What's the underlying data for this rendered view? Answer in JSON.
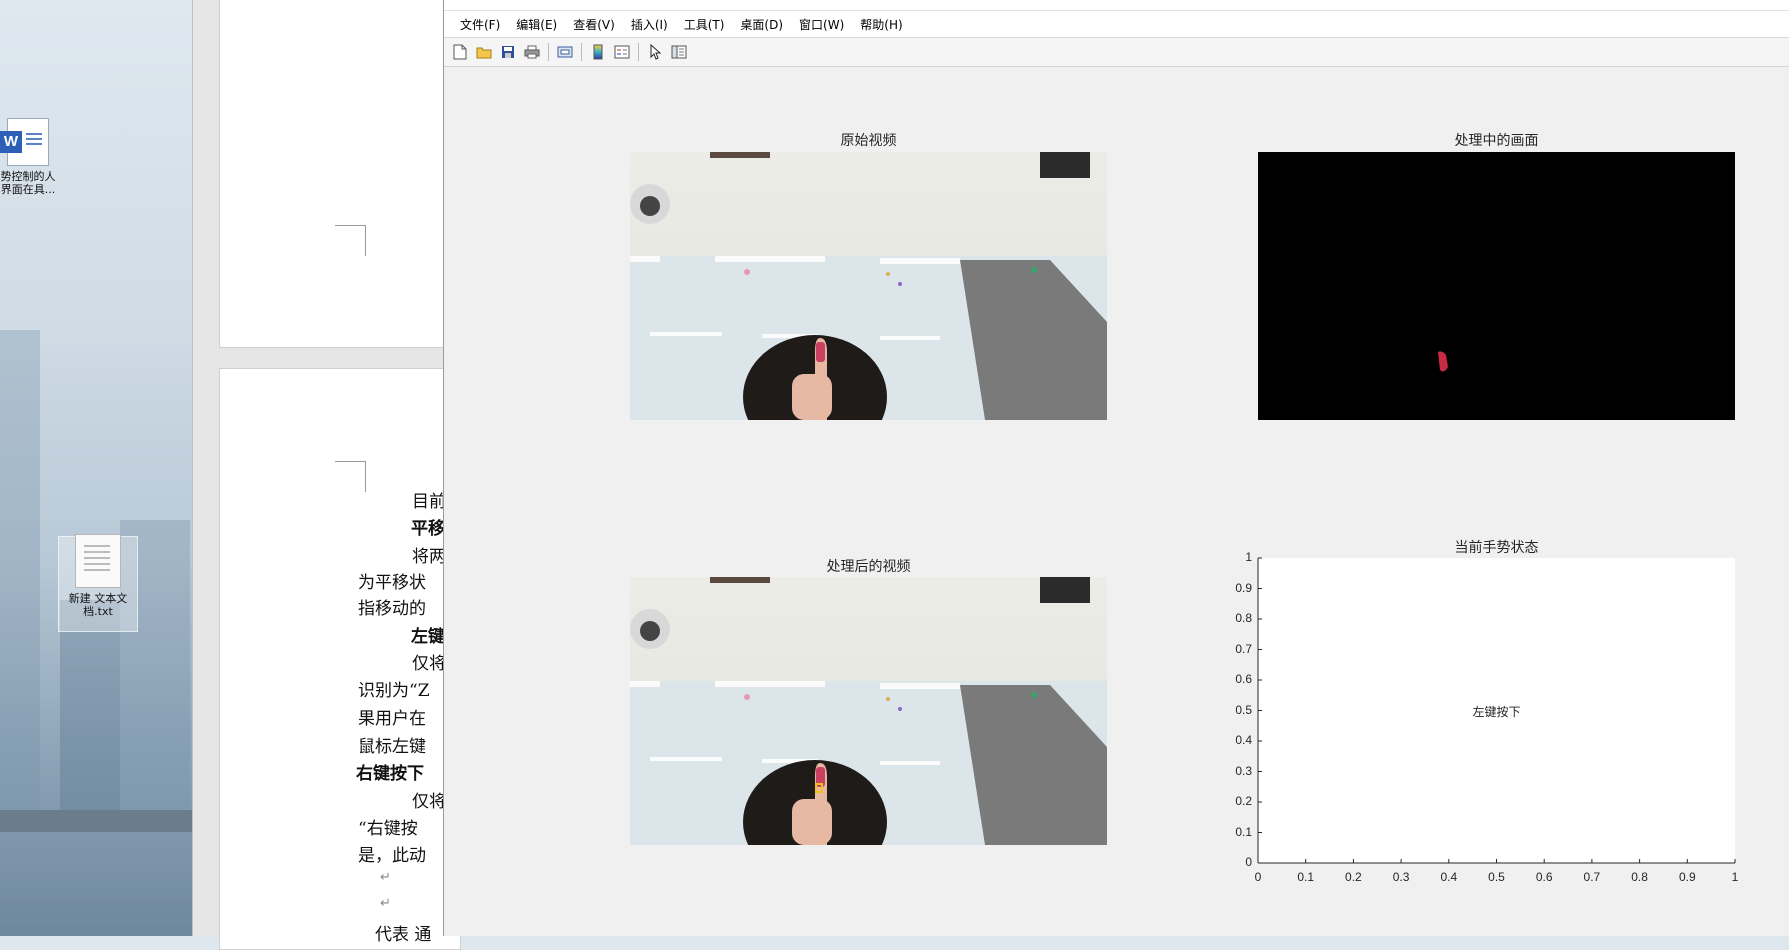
{
  "desktop": {
    "icons": [
      {
        "label_line1": "势控制的人",
        "label_line2": "界面在具..."
      },
      {
        "label_line1": "新建 文本文",
        "label_line2": "档.txt"
      }
    ]
  },
  "document": {
    "lines": [
      {
        "text": "目前",
        "bold": false
      },
      {
        "text": "平移",
        "bold": true
      },
      {
        "text": "将两",
        "bold": false
      },
      {
        "text": "为平移状",
        "bold": false
      },
      {
        "text": "指移动的",
        "bold": false
      },
      {
        "text": "左键",
        "bold": true
      },
      {
        "text": "仅将",
        "bold": false
      },
      {
        "text": "识别为“Z",
        "bold": false
      },
      {
        "text": "果用户在",
        "bold": false
      },
      {
        "text": "鼠标左键",
        "bold": false
      },
      {
        "text": "右键按下",
        "bold": true
      },
      {
        "text": "仅将",
        "bold": false
      },
      {
        "text": "“右键按",
        "bold": false
      },
      {
        "text": "是，此动",
        "bold": false
      },
      {
        "text": "↵",
        "bold": false
      },
      {
        "text": "↵",
        "bold": false
      },
      {
        "text": "代表 通",
        "bold": false
      }
    ]
  },
  "figure": {
    "menu": [
      "文件(F)",
      "编辑(E)",
      "查看(V)",
      "插入(I)",
      "工具(T)",
      "桌面(D)",
      "窗口(W)",
      "帮助(H)"
    ],
    "toolbar": [
      "new-icon",
      "open-icon",
      "save-icon",
      "print-icon",
      "print-preview-icon",
      "colorbar-icon",
      "legend-icon",
      "pointer-icon",
      "property-editor-icon"
    ],
    "axes": {
      "original": {
        "title": "原始视频"
      },
      "processing": {
        "title": "处理中的画面"
      },
      "processed": {
        "title": "处理后的视频"
      },
      "gesture": {
        "title": "当前手势状态",
        "status_text": "左键按下",
        "x_ticks": [
          "0",
          "0.1",
          "0.2",
          "0.3",
          "0.4",
          "0.5",
          "0.6",
          "0.7",
          "0.8",
          "0.9",
          "1"
        ],
        "y_ticks": [
          "0",
          "0.1",
          "0.2",
          "0.3",
          "0.4",
          "0.5",
          "0.6",
          "0.7",
          "0.8",
          "0.9",
          "1"
        ]
      }
    }
  }
}
